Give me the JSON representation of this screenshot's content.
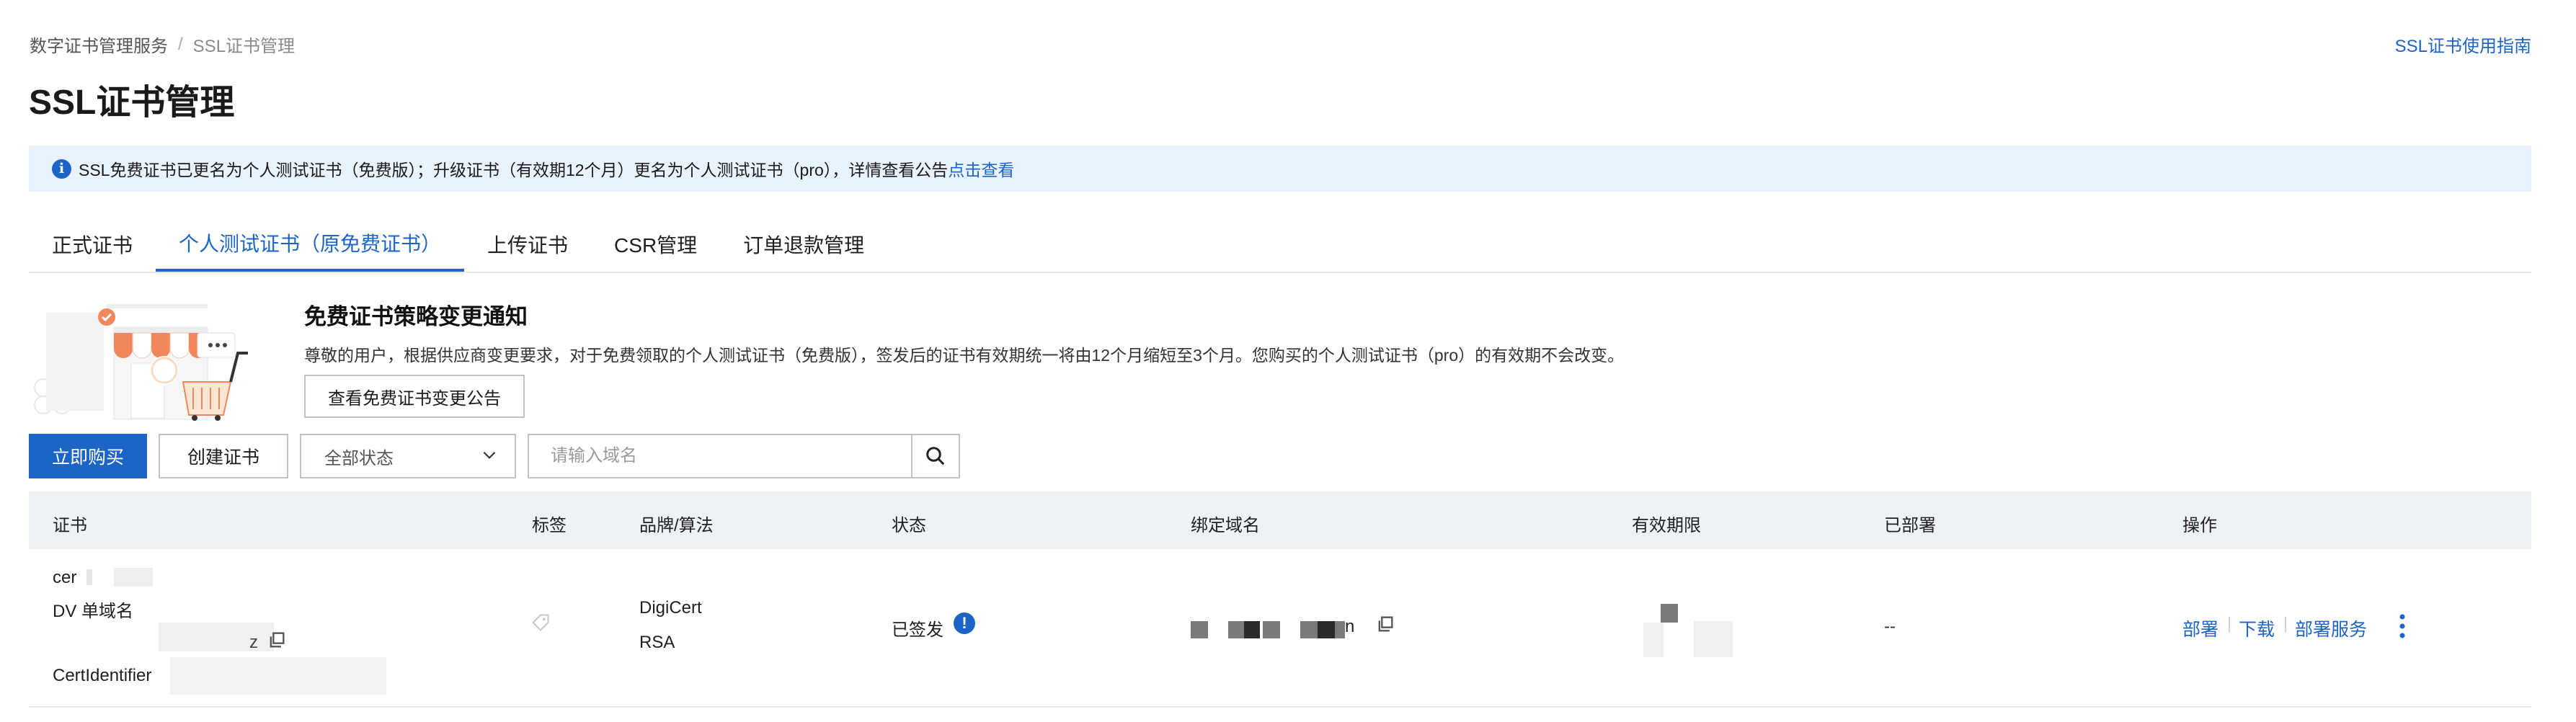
{
  "breadcrumb": {
    "parent": "数字证书管理服务",
    "separator": "/",
    "current": "SSL证书管理"
  },
  "header": {
    "guide_link": "SSL证书使用指南",
    "title": "SSL证书管理"
  },
  "notice": {
    "text": "SSL免费证书已更名为个人测试证书（免费版）；升级证书（有效期12个月）更名为个人测试证书（pro），详情查看公告",
    "link": "点击查看"
  },
  "tabs": [
    {
      "label": "正式证书",
      "active": false
    },
    {
      "label": "个人测试证书（原免费证书）",
      "active": true
    },
    {
      "label": "上传证书",
      "active": false
    },
    {
      "label": "CSR管理",
      "active": false
    },
    {
      "label": "订单退款管理",
      "active": false
    }
  ],
  "announcement": {
    "title": "免费证书策略变更通知",
    "body": "尊敬的用户，根据供应商变更要求，对于免费领取的个人测试证书（免费版），签发后的证书有效期统一将由12个月缩短至3个月。您购买的个人测试证书（pro）的有效期不会改变。",
    "button": "查看免费证书变更公告"
  },
  "toolbar": {
    "buy": "立即购买",
    "create": "创建证书",
    "status_select": "全部状态",
    "search_placeholder": "请输入域名"
  },
  "table": {
    "columns": [
      "证书",
      "标签",
      "品牌/算法",
      "状态",
      "绑定域名",
      "有效期限",
      "已部署",
      "操作"
    ],
    "rows": [
      {
        "cert_name": "cer",
        "cert_type": "DV 单域名",
        "cert_id_suffix": "z",
        "cert_identifier_label": "CertIdentifier",
        "brand": "DigiCert",
        "algorithm": "RSA",
        "status": "已签发",
        "domain_suffix": "n",
        "deployed": "--",
        "actions": [
          "部署",
          "下载",
          "部署服务"
        ]
      }
    ]
  },
  "colors": {
    "accent": "#1d64c7",
    "notice_bg": "#e9f3fe",
    "table_header_bg": "#eef1f6"
  }
}
